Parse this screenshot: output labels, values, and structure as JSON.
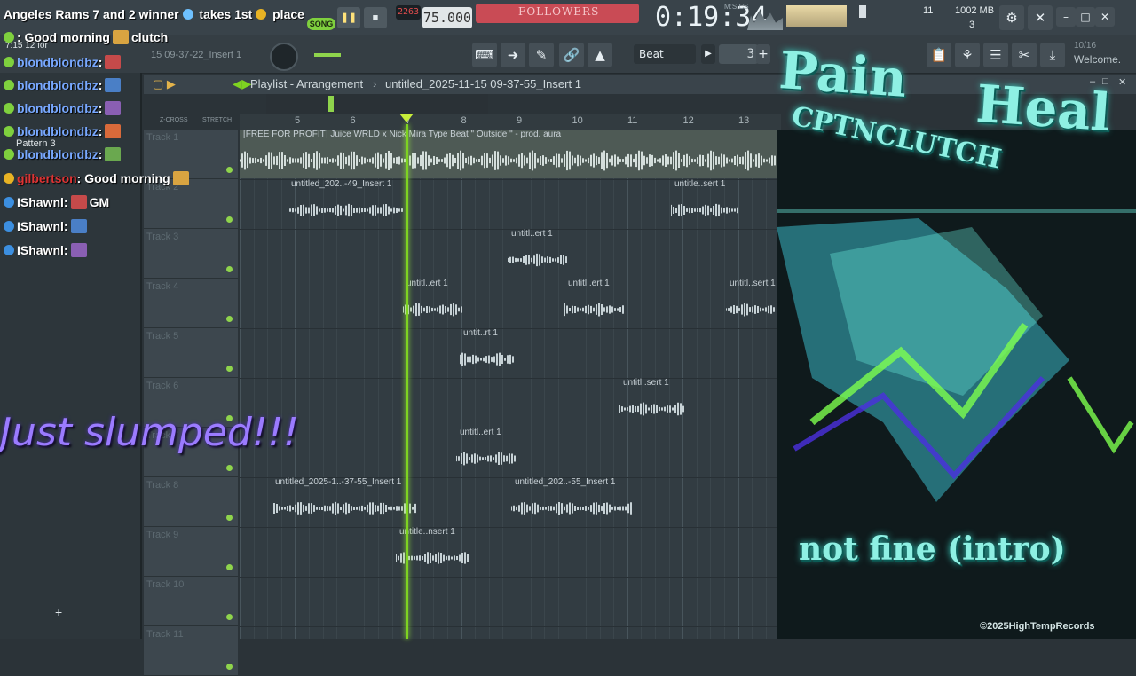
{
  "ticker": {
    "text": "Angeles Rams 7 and 2 winner",
    "takes": "takes 1st",
    "place": "place"
  },
  "transport": {
    "song_label": "SONG",
    "tempo": "75.000",
    "time": "0:19:34",
    "bst": "M:S:CS",
    "cpu_mem": "1002 MB",
    "voices": "3",
    "cpu_num": "11"
  },
  "followers": "FOLLOWERS",
  "counter": "2263",
  "snap": {
    "label": "Beat",
    "value": "3"
  },
  "welcome": {
    "top": "10/16",
    "label": "Welcome."
  },
  "playlist": {
    "title": "Playlist - Arrangement",
    "project": "untitled_2025-11-15 09-37-55_Insert 1",
    "left_file": "15 09-37-22_Insert 1",
    "xcross": "Z-CROSS",
    "stretch": "STRETCH",
    "pattern": "Pattern 3",
    "time_label": "7:15 12 for"
  },
  "ruler": [
    "5",
    "6",
    "7",
    "8",
    "9",
    "10",
    "11",
    "12",
    "13"
  ],
  "tracks": [
    "Track 1",
    "Track 2",
    "Track 3",
    "Track 4",
    "Track 5",
    "Track 6",
    "Track 7",
    "Track 8",
    "Track 9",
    "Track 10",
    "Track 11"
  ],
  "clips": [
    {
      "name": "[FREE FOR PROFIT] Juice WRLD x Nick Mira Type Beat \" Outside \" - prod. aura"
    },
    {
      "name": "untitled_202..-49_Insert 1"
    },
    {
      "name": "untitle..sert 1"
    },
    {
      "name": "untitl..ert 1"
    },
    {
      "name": "untitl..ert 1"
    },
    {
      "name": "untitl..ert 1"
    },
    {
      "name": "untitl..sert 1"
    },
    {
      "name": "untit..rt 1"
    },
    {
      "name": "untitl..sert 1"
    },
    {
      "name": "untitl..ert 1"
    },
    {
      "name": "untitled_2025-1..-37-55_Insert 1"
    },
    {
      "name": "untitled_202..-55_Insert 1"
    },
    {
      "name": "untitle..nsert 1"
    }
  ],
  "chat": [
    {
      "user": "",
      "msg": ": Good morning",
      "tail": "clutch"
    },
    {
      "user": "blondblondbz",
      "msg": ":"
    },
    {
      "user": "blondblondbz",
      "msg": ":"
    },
    {
      "user": "blondblondbz",
      "msg": ":"
    },
    {
      "user": "blondblondbz",
      "msg": ":"
    },
    {
      "user": "blondblondbz",
      "msg": ":"
    },
    {
      "user": "gilbertson",
      "msg": ": Good morning"
    },
    {
      "user": "IShawnl",
      "msg": ":",
      "tail": "GM"
    },
    {
      "user": "IShawnl",
      "msg": ":"
    },
    {
      "user": "IShawnl",
      "msg": ":"
    }
  ],
  "overlay_text": "Just slumped!!!",
  "art": {
    "title1": "Pain",
    "title2": "Heal",
    "subtitle": "CPTNCLUTCH",
    "track": "not fine (intro)",
    "credit": "©2025HighTempRecords"
  },
  "colors": {
    "accent": "#7ed321",
    "chat_user": "#78a8ff",
    "art_text": "#8ef0e3"
  }
}
